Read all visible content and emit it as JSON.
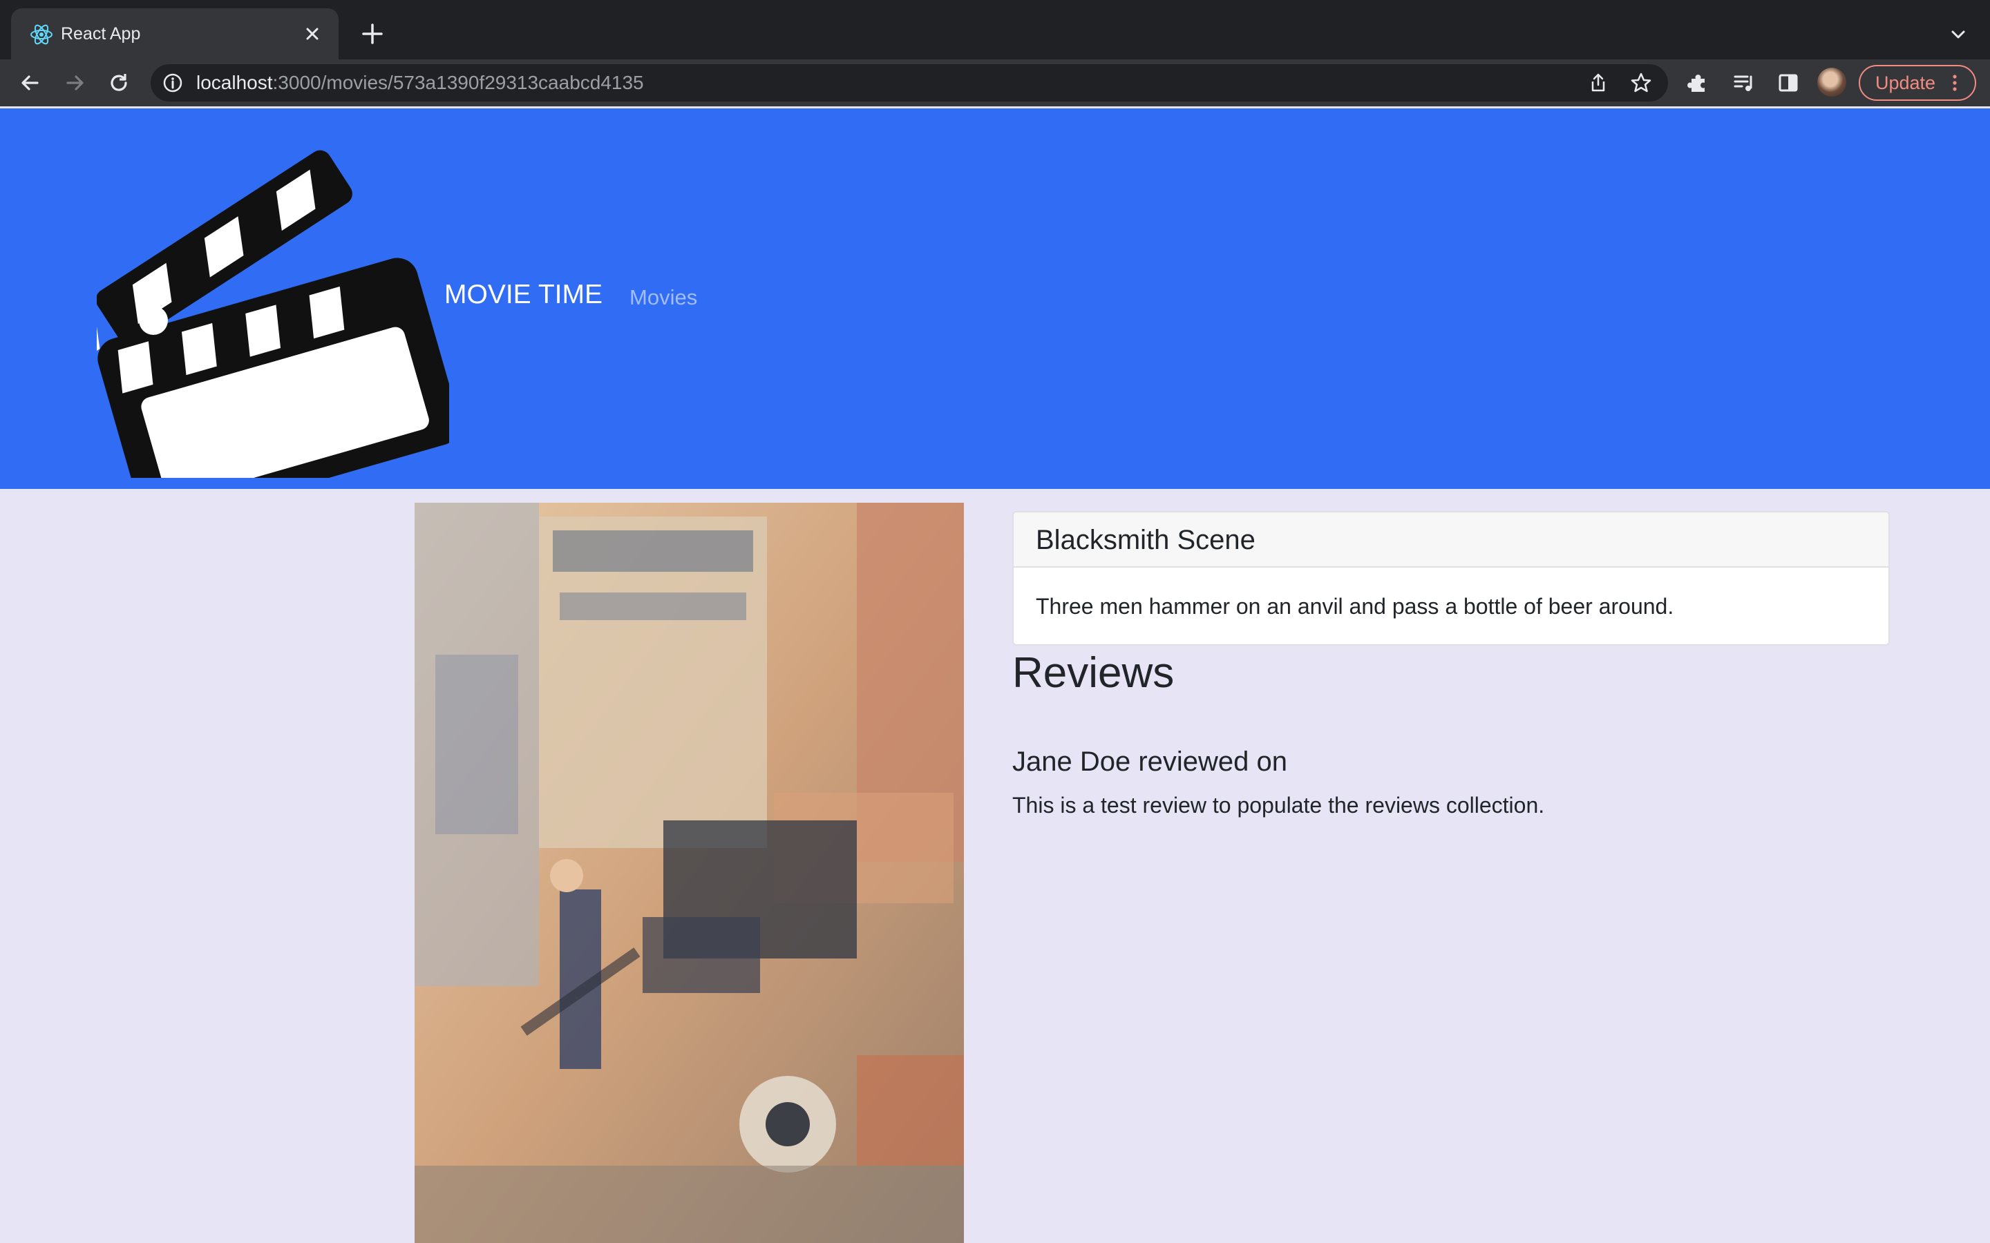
{
  "browser": {
    "tab_title": "React App",
    "url_host": "localhost",
    "url_path": ":3000/movies/573a1390f29313caabcd4135",
    "update_label": "Update",
    "icons": {
      "favicon": "react-icon",
      "back": "arrow-left-icon",
      "forward": "arrow-right-icon",
      "reload": "reload-icon",
      "info": "info-icon",
      "share": "share-icon",
      "bookmark": "star-icon",
      "extensions": "puzzle-icon",
      "media": "playlist-icon",
      "sidepanel": "side-panel-icon",
      "menu": "kebab-menu-icon"
    }
  },
  "navbar": {
    "brand": "MOVIE TIME",
    "links": [
      "Movies"
    ],
    "background_color": "#316cf4"
  },
  "movie": {
    "title": "Blacksmith Scene",
    "plot": "Three men hammer on an anvil and pass a bottle of beer around."
  },
  "reviews": {
    "heading": "Reviews",
    "items": [
      {
        "author_line": "Jane Doe reviewed on",
        "text": "This is a test review to populate the reviews collection."
      }
    ]
  },
  "colors": {
    "page_background": "#e6e4f5",
    "update_accent": "#f28b82"
  }
}
